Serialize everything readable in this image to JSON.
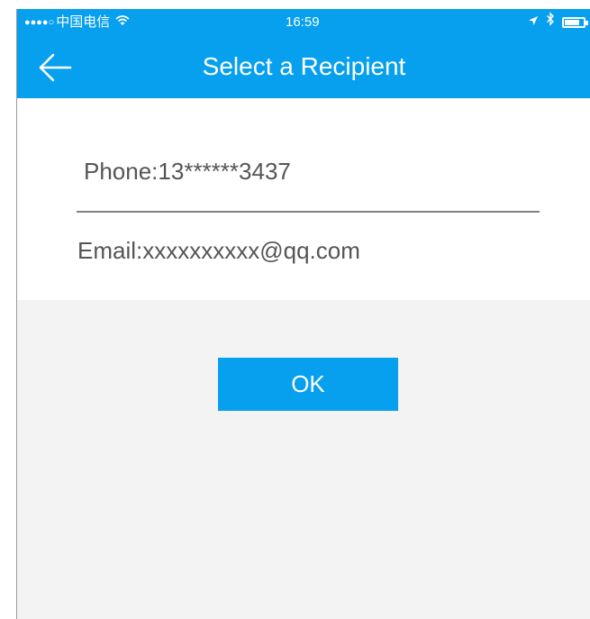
{
  "status_bar": {
    "signal_dots": "●●●●○",
    "carrier": "中国电信",
    "wifi_icon": "wifi-icon",
    "time": "16:59",
    "location_icon": "location-arrow-icon",
    "bluetooth_icon": "bluetooth-icon",
    "battery_icon": "battery-icon"
  },
  "header": {
    "back_icon": "back-arrow-icon",
    "title": "Select a Recipient"
  },
  "form": {
    "phone": "Phone:13******3437",
    "email": "Email:xxxxxxxxxx@qq.com"
  },
  "actions": {
    "ok_label": "OK"
  },
  "colors": {
    "accent": "#06a0ef",
    "background": "#f3f3f3",
    "card": "#ffffff",
    "text": "#555555"
  }
}
